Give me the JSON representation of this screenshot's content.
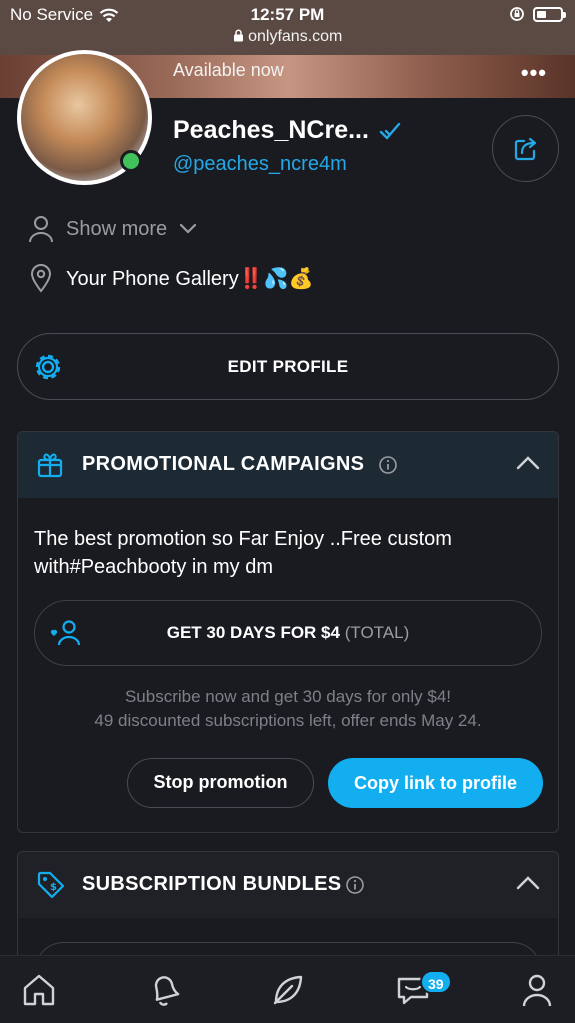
{
  "status_bar": {
    "carrier": "No Service",
    "time": "12:57 PM",
    "url": "onlyfans.com"
  },
  "cover": {
    "availability": "Available now",
    "more_icon": "more-horizontal-icon"
  },
  "profile": {
    "display_name": "Peaches_NCre...",
    "username": "@peaches_ncre4m",
    "verified_icon": "verified-check-icon",
    "online": true,
    "show_more_label": "Show more",
    "location_text": "Your Phone Gallery‼️💦💰"
  },
  "edit_profile": {
    "label": "EDIT PROFILE"
  },
  "promotional_campaigns": {
    "title": "PROMOTIONAL CAMPAIGNS",
    "description": "The best promotion so Far Enjoy ..Free custom with#Peachbooty in my dm",
    "offer_label": "GET 30 DAYS FOR $4",
    "offer_suffix": "(TOTAL)",
    "offer_line1": "Subscribe now and get 30 days for only $4!",
    "offer_line2": "49 discounted subscriptions left, offer ends May 24.",
    "stop_label": "Stop promotion",
    "copy_label": "Copy link to profile"
  },
  "subscription_bundles": {
    "title": "SUBSCRIPTION BUNDLES"
  },
  "bottom_nav": {
    "items": [
      "home-icon",
      "notifications-icon",
      "feed-icon",
      "messages-icon",
      "profile-icon"
    ],
    "messages_badge": "39"
  },
  "colors": {
    "accent": "#12aef0",
    "username": "#24a8e6",
    "background": "#1a1b20",
    "online": "#41c15c"
  }
}
